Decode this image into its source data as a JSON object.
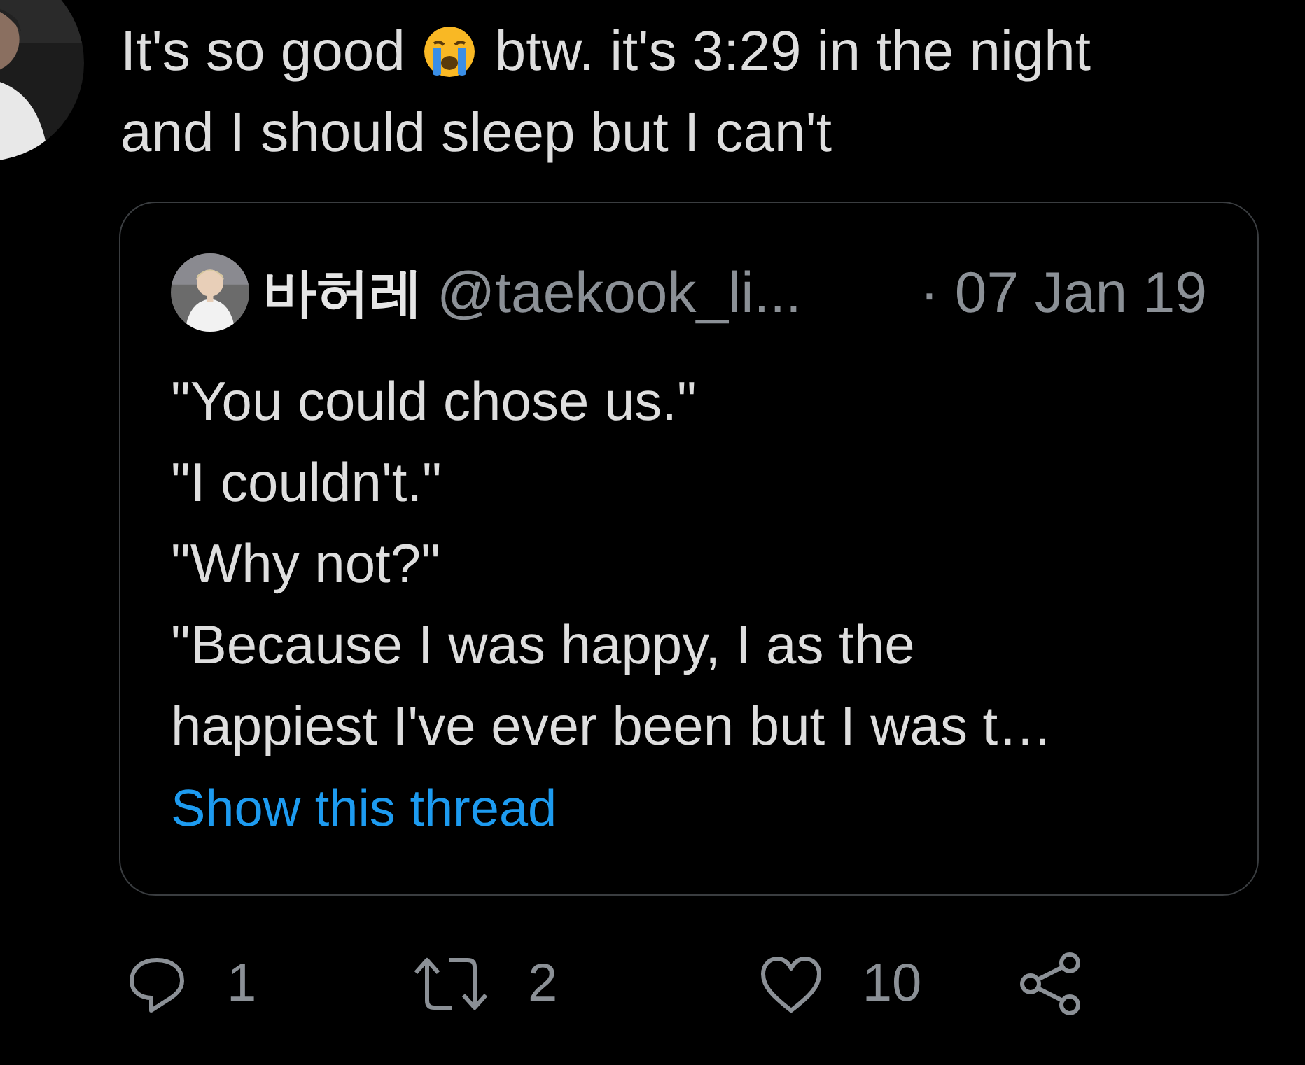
{
  "tweet": {
    "text_lines": [
      {
        "parts": [
          {
            "kind": "text",
            "text": "It's so good"
          },
          {
            "kind": "emoji"
          },
          {
            "kind": "text",
            "text": "btw. it's 3:29 in the night"
          }
        ]
      },
      {
        "parts": [
          {
            "kind": "text",
            "text": "and I should sleep but I can't"
          }
        ]
      }
    ],
    "quoted_tweet": {
      "name": "바허레",
      "handle": "@taekook_li...",
      "date": "· 07 Jan 19",
      "lines": [
        "\"You could chose us.\"",
        "\"I couldn't.\"",
        "\"Why not?\"",
        "\"Because I was happy, I as the happiest I've ever been but I was t…"
      ],
      "show_thread": "Show this thread"
    },
    "actions": [
      {
        "kind": "reply",
        "count": "1"
      },
      {
        "kind": "retweet",
        "count": "2"
      },
      {
        "kind": "like",
        "count": "10"
      },
      {
        "kind": "share"
      }
    ]
  }
}
